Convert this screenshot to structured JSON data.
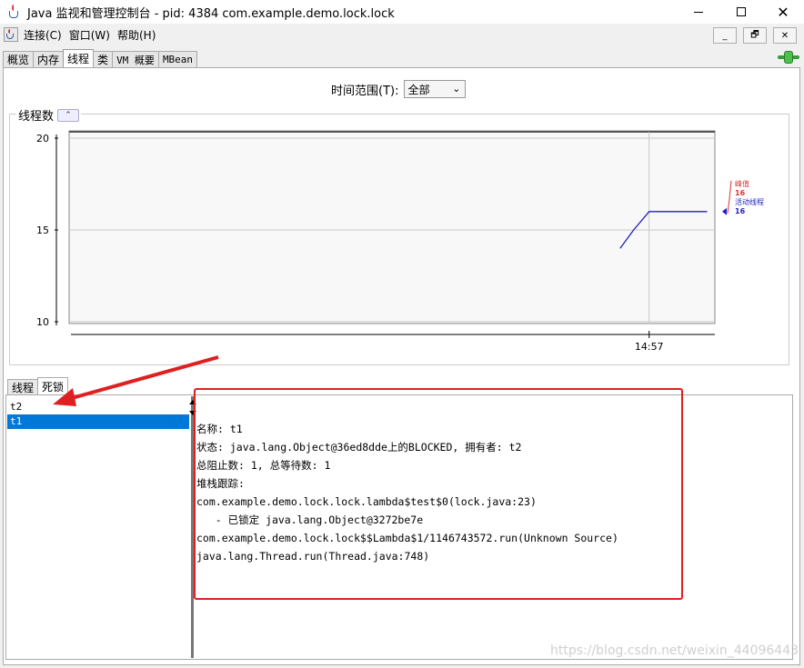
{
  "window": {
    "title": "Java 监视和管理控制台 - pid: 4384 com.example.demo.lock.lock",
    "controls": {
      "minimize": "—",
      "maximize": "☐",
      "close": "✕"
    }
  },
  "menu": {
    "items": [
      "连接(C)",
      "窗口(W)",
      "帮助(H)"
    ],
    "mdi": {
      "minimize": "_",
      "restore": "🗗",
      "close": "✕"
    }
  },
  "tabs": [
    {
      "label": "概览",
      "active": false
    },
    {
      "label": "内存",
      "active": false
    },
    {
      "label": "线程",
      "active": true
    },
    {
      "label": "类",
      "active": false
    },
    {
      "label": "VM 概要",
      "active": false
    },
    {
      "label": "MBean",
      "active": false
    }
  ],
  "time_range": {
    "label": "时间范围(T):",
    "value": "全部"
  },
  "chart": {
    "title": "线程数",
    "collapse_glyph": "⌃",
    "legend": {
      "peak_label": "峰值",
      "peak_value": "16",
      "live_label": "活动线程",
      "live_value": "16",
      "peak_color": "#e03030",
      "live_color": "#2020c0"
    }
  },
  "chart_data": {
    "type": "line",
    "x": [
      "14:56:45",
      "14:56:52",
      "14:57:00",
      "14:57:15",
      "14:57:30"
    ],
    "xtick_labels": [
      "14:57"
    ],
    "y_ticks": [
      10,
      15,
      20
    ],
    "ylim": [
      10,
      20
    ],
    "series": [
      {
        "name": "活动线程",
        "values": [
          14,
          15,
          16,
          16,
          16
        ],
        "color": "#2020c0"
      }
    ],
    "title": "线程数"
  },
  "lower": {
    "tabs": [
      "线程",
      "死锁"
    ],
    "active_tab": "死锁",
    "threads": [
      "t2",
      "t1"
    ],
    "selected_thread": "t1",
    "details": [
      "名称: t1",
      "状态: java.lang.Object@36ed8dde上的BLOCKED, 拥有者: t2",
      "总阻止数: 1, 总等待数: 1",
      "",
      "堆栈跟踪:",
      "com.example.demo.lock.lock.lambda$test$0(lock.java:23)",
      "   - 已锁定 java.lang.Object@3272be7e",
      "com.example.demo.lock.lock$$Lambda$1/1146743572.run(Unknown Source)",
      "java.lang.Thread.run(Thread.java:748)"
    ]
  },
  "annotations": {
    "highlight_color": "#e02020"
  },
  "watermark": "https://blog.csdn.net/weixin_44096443"
}
